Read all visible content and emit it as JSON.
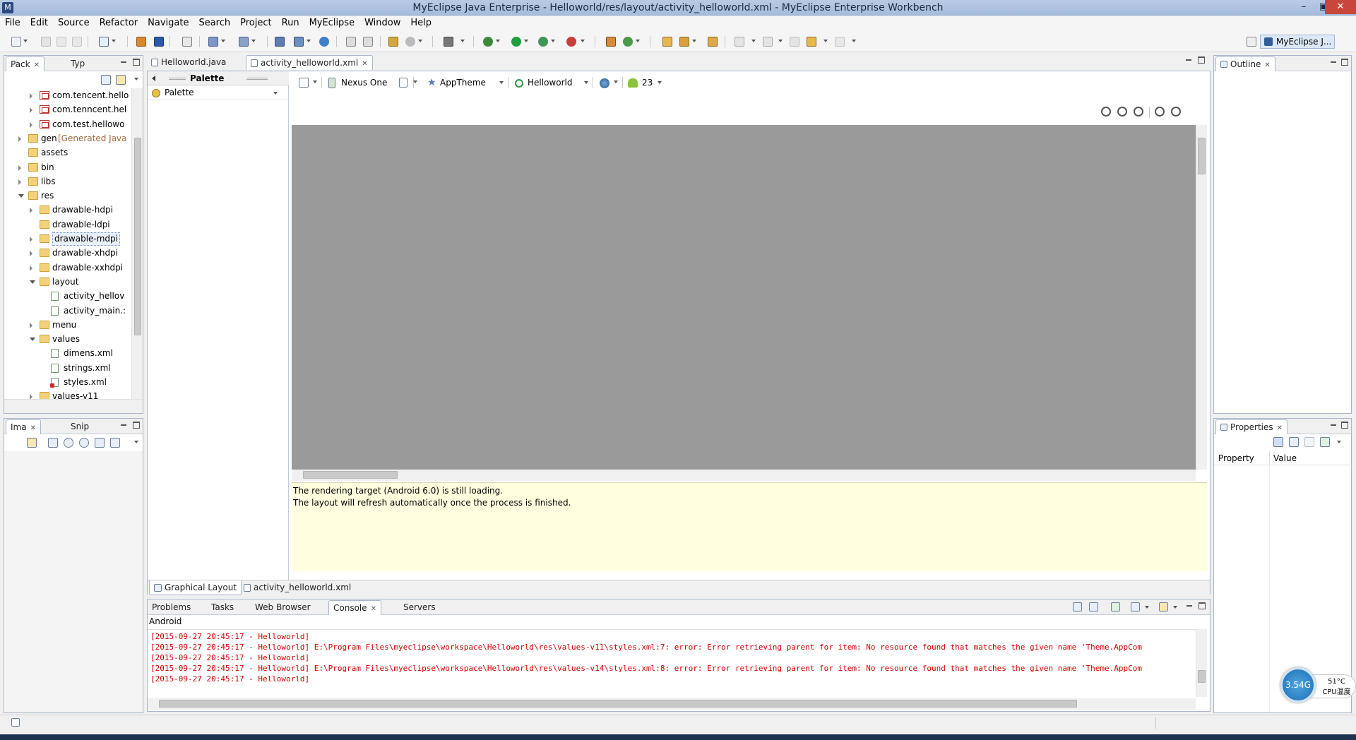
{
  "window": {
    "title": "MyEclipse Java Enterprise - Helloworld/res/layout/activity_helloworld.xml - MyEclipse Enterprise Workbench",
    "controls": [
      "–",
      "▣",
      "✕"
    ]
  },
  "menu": [
    "File",
    "Edit",
    "Source",
    "Refactor",
    "Navigate",
    "Search",
    "Project",
    "Run",
    "MyEclipse",
    "Window",
    "Help"
  ],
  "perspective": {
    "label": "MyEclipse J..."
  },
  "package_explorer": {
    "tabs": [
      {
        "label": "Pack"
      },
      {
        "label": "Typ"
      }
    ],
    "tree": [
      {
        "label": "com.tencent.hello",
        "icon": "package-icon",
        "level": 2,
        "expander": "collapsed"
      },
      {
        "label": "com.tenncent.hel",
        "icon": "package-icon",
        "level": 2,
        "expander": "collapsed"
      },
      {
        "label": "com.test.hellowo",
        "icon": "package-icon",
        "level": 2,
        "expander": "collapsed"
      },
      {
        "label": "gen",
        "suffix": "[Generated Java",
        "icon": "source-folder-icon",
        "level": 1,
        "expander": "collapsed"
      },
      {
        "label": "assets",
        "icon": "folder-icon",
        "level": 1,
        "expander": "none"
      },
      {
        "label": "bin",
        "icon": "folder-icon",
        "level": 1,
        "expander": "collapsed"
      },
      {
        "label": "libs",
        "icon": "folder-icon",
        "level": 1,
        "expander": "collapsed"
      },
      {
        "label": "res",
        "icon": "folder-icon",
        "level": 1,
        "expander": "expanded"
      },
      {
        "label": "drawable-hdpi",
        "icon": "folder-icon",
        "level": 2,
        "expander": "collapsed"
      },
      {
        "label": "drawable-ldpi",
        "icon": "folder-icon",
        "level": 2,
        "expander": "none"
      },
      {
        "label": "drawable-mdpi",
        "icon": "folder-icon",
        "level": 2,
        "expander": "collapsed",
        "selected": true
      },
      {
        "label": "drawable-xhdpi",
        "icon": "folder-icon",
        "level": 2,
        "expander": "collapsed"
      },
      {
        "label": "drawable-xxhdpi",
        "icon": "folder-icon",
        "level": 2,
        "expander": "collapsed"
      },
      {
        "label": "layout",
        "icon": "folder-icon",
        "level": 2,
        "expander": "expanded"
      },
      {
        "label": "activity_hellov",
        "icon": "xml-file-icon",
        "level": 3,
        "expander": "none"
      },
      {
        "label": "activity_main.:",
        "icon": "xml-file-icon",
        "level": 3,
        "expander": "none"
      },
      {
        "label": "menu",
        "icon": "folder-icon",
        "level": 2,
        "expander": "collapsed"
      },
      {
        "label": "values",
        "icon": "folder-icon",
        "level": 2,
        "expander": "expanded"
      },
      {
        "label": "dimens.xml",
        "icon": "xml-file-icon",
        "level": 3,
        "expander": "none"
      },
      {
        "label": "strings.xml",
        "icon": "xml-file-icon",
        "level": 3,
        "expander": "none"
      },
      {
        "label": "styles.xml",
        "icon": "xml-error-file-icon",
        "level": 3,
        "expander": "none"
      },
      {
        "label": "values-v11",
        "icon": "folder-icon",
        "level": 2,
        "expander": "collapsed"
      }
    ]
  },
  "image_panel": {
    "tabs": [
      {
        "label": "Ima"
      },
      {
        "label": "Snip"
      }
    ]
  },
  "editor": {
    "tabs": [
      {
        "label": "Helloworld.java"
      },
      {
        "label": "activity_helloworld.xml"
      }
    ],
    "palette": {
      "title": "Palette",
      "dropdown": "Palette"
    },
    "config_toolbar": {
      "device": "Nexus One",
      "theme": "AppTheme",
      "activity": "Helloworld",
      "api": "23"
    },
    "message": {
      "line1": "The rendering target (Android 6.0) is still loading.",
      "line2": "The layout will refresh automatically once the process is finished."
    },
    "bottom_tabs": [
      {
        "label": "Graphical Layout"
      },
      {
        "label": "activity_helloworld.xml"
      }
    ]
  },
  "outline": {
    "tab": "Outline"
  },
  "properties": {
    "tab": "Properties",
    "columns": [
      "Property",
      "Value"
    ]
  },
  "console": {
    "tabs": [
      {
        "label": "Problems"
      },
      {
        "label": "Tasks"
      },
      {
        "label": "Web Browser"
      },
      {
        "label": "Console"
      },
      {
        "label": "Servers"
      }
    ],
    "header": "Android",
    "lines": [
      "[2015-09-27 20:45:17 - Helloworld]",
      "[2015-09-27 20:45:17 - Helloworld] E:\\Program Files\\myeclipse\\workspace\\Helloworld\\res\\values-v11\\styles.xml:7: error: Error retrieving parent for item: No resource found that matches the given name 'Theme.AppCom",
      "[2015-09-27 20:45:17 - Helloworld]",
      "[2015-09-27 20:45:17 - Helloworld] E:\\Program Files\\myeclipse\\workspace\\Helloworld\\res\\values-v14\\styles.xml:8: error: Error retrieving parent for item: No resource found that matches the given name 'Theme.AppCom",
      "[2015-09-27 20:45:17 - Helloworld]"
    ]
  },
  "widget": {
    "memory": "3.54G",
    "temp": "51°C",
    "cpu_label": "CPU温度"
  }
}
